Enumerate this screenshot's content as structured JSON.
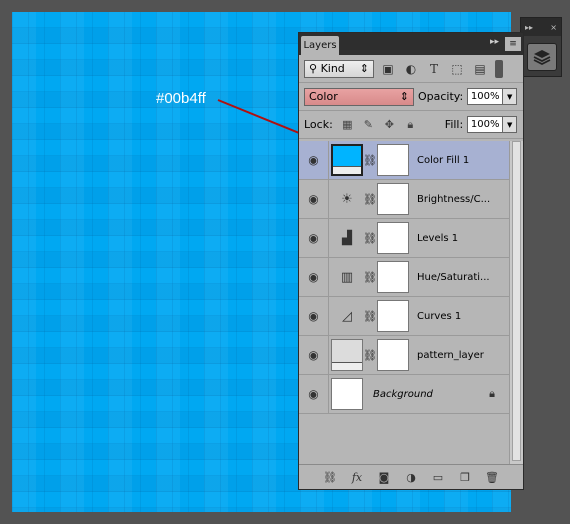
{
  "annotation": {
    "label": "#00b4ff"
  },
  "panel": {
    "tab_label": "Layers",
    "tab_collapse": "▸▸",
    "menu_icon": "≡",
    "filter": {
      "kind_label": "Kind",
      "icons": [
        "image-icon",
        "adjustment-icon",
        "type-icon",
        "shape-icon",
        "smart-object-icon"
      ]
    },
    "blend": {
      "mode": "Color",
      "opacity_label": "Opacity:",
      "opacity_value": "100%"
    },
    "lock": {
      "label": "Lock:",
      "fill_label": "Fill:",
      "fill_value": "100%"
    },
    "layers": [
      {
        "name": "Color Fill 1",
        "selected": true,
        "thumb": "fill"
      },
      {
        "name": "Brightness/C...",
        "thumb": "brightness"
      },
      {
        "name": "Levels 1",
        "thumb": "levels"
      },
      {
        "name": "Hue/Saturati...",
        "thumb": "hue"
      },
      {
        "name": "Curves 1",
        "thumb": "curves"
      },
      {
        "name": "pattern_layer",
        "thumb": "pattern"
      },
      {
        "name": "Background",
        "thumb": "background"
      }
    ]
  },
  "colors": {
    "fill_color": "#00b4ff",
    "canvas": "#00a8f2",
    "selected_row": "#a7b1d2"
  }
}
